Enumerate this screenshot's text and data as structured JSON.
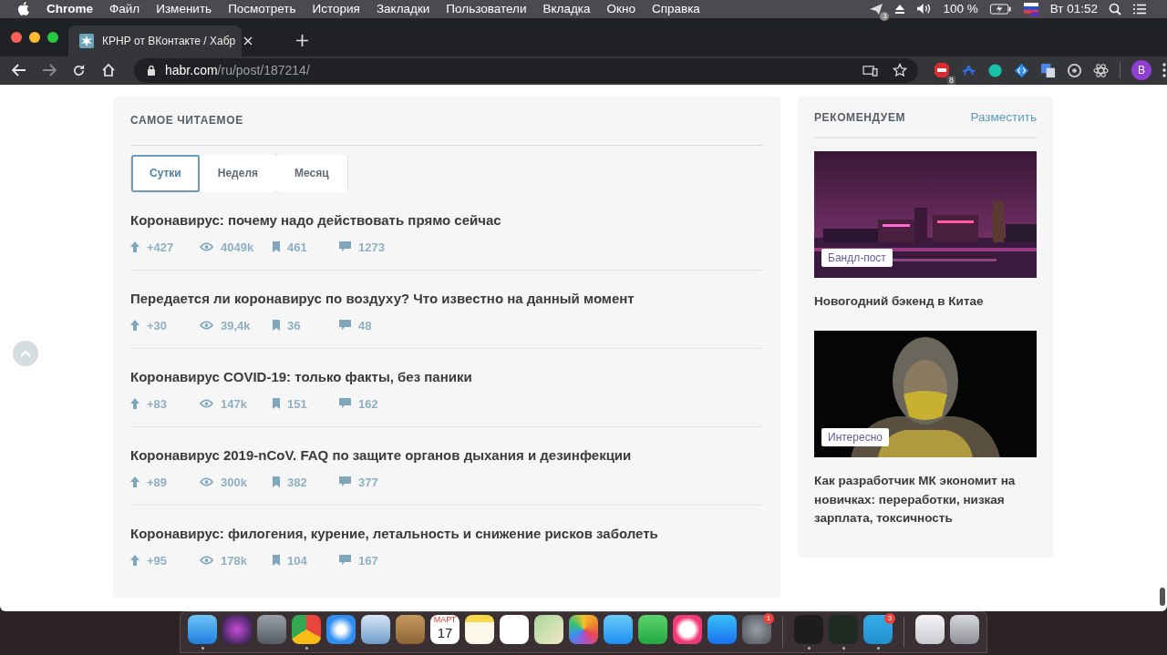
{
  "menu_bar": {
    "app": "Chrome",
    "items": [
      "Файл",
      "Изменить",
      "Посмотреть",
      "История",
      "Закладки",
      "Пользователи",
      "Вкладка",
      "Окно",
      "Справка"
    ],
    "notification_count": "3",
    "battery": "100 %",
    "clock": "Вт 01:52"
  },
  "browser": {
    "tab_title": "КРНР от ВКонтакте / Хабр",
    "url_host": "habr.com",
    "url_path": "/ru/post/187214/",
    "adblock_count": "8",
    "profile_initial": "B"
  },
  "most_read": {
    "title": "САМОЕ ЧИТАЕМОЕ",
    "tabs": [
      {
        "label": "Сутки",
        "selected": true
      },
      {
        "label": "Неделя",
        "selected": false
      },
      {
        "label": "Месяц",
        "selected": false
      }
    ],
    "posts": [
      {
        "title": "Коронавирус: почему надо действовать прямо сейчас",
        "votes": "+427",
        "views": "4049k",
        "bookmarks": "461",
        "comments": "1273"
      },
      {
        "title": "Передается ли коронавирус по воздуху? Что известно на данный момент",
        "votes": "+30",
        "views": "39,4k",
        "bookmarks": "36",
        "comments": "48"
      },
      {
        "title": "Коронавирус COVID-19: только факты, без паники",
        "votes": "+83",
        "views": "147k",
        "bookmarks": "151",
        "comments": "162"
      },
      {
        "title": "Коронавирус 2019-nCoV. FAQ по защите органов дыхания и дезинфекции",
        "votes": "+89",
        "views": "300k",
        "bookmarks": "382",
        "comments": "377"
      },
      {
        "title": "Коронавирус: филогения, курение, летальность и снижение рисков заболеть",
        "votes": "+95",
        "views": "178k",
        "bookmarks": "104",
        "comments": "167"
      }
    ]
  },
  "recommend": {
    "title": "РЕКОМЕНДУЕМ",
    "action": "Разместить",
    "items": [
      {
        "kind": "city",
        "tag": "Бандл-пост",
        "title": "Новогодний бэкенд в Китае"
      },
      {
        "kind": "figure",
        "tag": "Интересно",
        "title": "Как разработчик МК экономит на новичках: переработки, низкая зарплата, токсичность"
      }
    ]
  },
  "dock": {
    "groups": [
      [
        {
          "kind": "finder",
          "running": true
        },
        {
          "kind": "siri",
          "running": false
        },
        {
          "kind": "launchpad",
          "running": false
        },
        {
          "kind": "chrome",
          "running": true
        },
        {
          "kind": "safari",
          "running": false
        },
        {
          "kind": "mail",
          "running": false
        },
        {
          "kind": "contacts",
          "running": false
        },
        {
          "kind": "calendar",
          "running": false,
          "month": "МАРТ",
          "day": "17"
        },
        {
          "kind": "notes",
          "running": false
        },
        {
          "kind": "reminders",
          "running": false
        },
        {
          "kind": "maps",
          "running": false
        },
        {
          "kind": "photos",
          "running": false
        },
        {
          "kind": "messages",
          "running": false
        },
        {
          "kind": "facetime",
          "running": false
        },
        {
          "kind": "music",
          "running": false
        },
        {
          "kind": "appstore",
          "running": false
        },
        {
          "kind": "settings",
          "running": false,
          "badge": "1"
        }
      ],
      [
        {
          "kind": "terminal",
          "running": true
        },
        {
          "kind": "activity",
          "running": true
        },
        {
          "kind": "telegram",
          "running": true,
          "badge": "3"
        }
      ],
      [
        {
          "kind": "downloads",
          "running": false
        },
        {
          "kind": "trash",
          "running": false
        }
      ]
    ]
  }
}
